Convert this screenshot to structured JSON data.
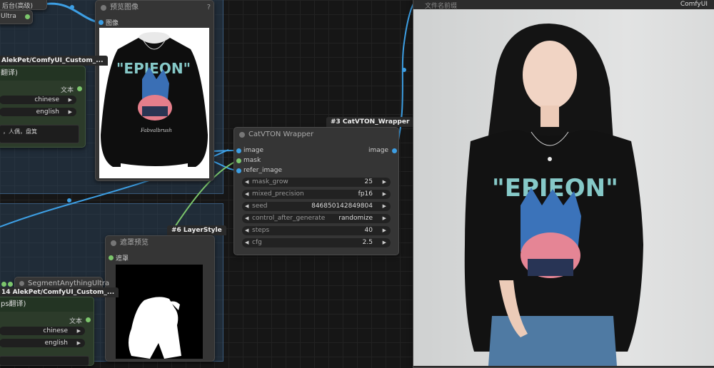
{
  "colors": {
    "link_blue": "#3d9fe4",
    "link_green": "#7cc66c",
    "canvas": "#161616",
    "node": "#353535"
  },
  "top_left": {
    "title_fragment": "后台(高级)",
    "ultra_label": "Ultra"
  },
  "preview_node": {
    "title": "预览图像",
    "input_label": "图像",
    "menu_icon": "?"
  },
  "translate_node_top": {
    "tag": "AlekPet/ComfyUI_Custom_...",
    "title": "翻译)",
    "output_label": "文本",
    "from_lang": "chinese",
    "to_lang": "english",
    "text": "，人偶，盘箕"
  },
  "catvton_node": {
    "tag": "#3 CatVTON_Wrapper",
    "title": "CatVTON Wrapper",
    "inputs": [
      "image",
      "mask",
      "refer_image"
    ],
    "output": "image",
    "widgets": [
      {
        "name": "mask_grow",
        "value": "25"
      },
      {
        "name": "mixed_precision",
        "value": "fp16"
      },
      {
        "name": "seed",
        "value": "846850142849804"
      },
      {
        "name": "control_after_generate",
        "value": "randomize"
      },
      {
        "name": "steps",
        "value": "40"
      },
      {
        "name": "cfg",
        "value": "2.5"
      }
    ]
  },
  "layerstyle_tag": "#6 LayerStyle",
  "mask_preview_node": {
    "title": "遮罩预览",
    "input_label": "遮罩"
  },
  "segment_node": {
    "title": "SegmentAnythingUltra",
    "tag": "14 AlekPet/ComfyUI_Custom_..."
  },
  "translate_node_bottom": {
    "title": "ps翻译)",
    "output_label": "文本",
    "from_lang": "chinese",
    "to_lang": "english"
  },
  "output_panel": {
    "header_left": "文件名前缀",
    "header_right": "ComfyUI"
  },
  "shirt_print": {
    "brand_text": "\"EPIEON\"",
    "signature": "Fabvalbrush"
  }
}
